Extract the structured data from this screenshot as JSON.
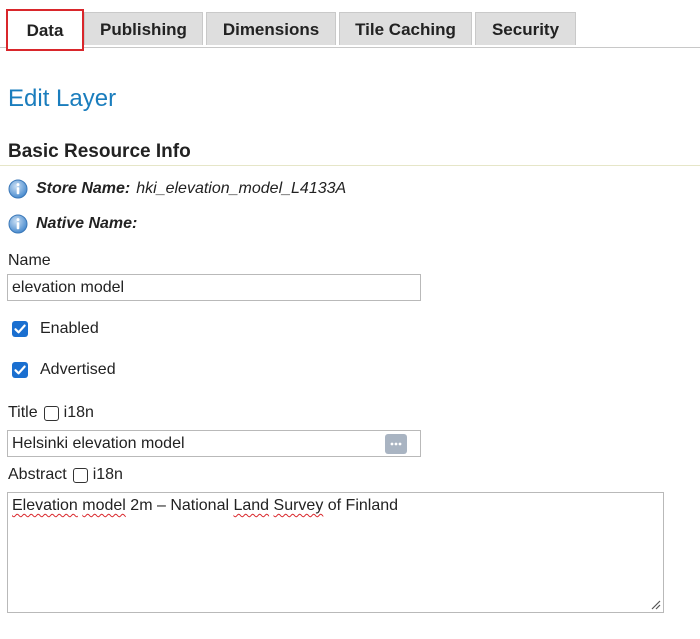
{
  "tabs": [
    {
      "label": "Data",
      "active": true
    },
    {
      "label": "Publishing",
      "active": false
    },
    {
      "label": "Dimensions",
      "active": false
    },
    {
      "label": "Tile Caching",
      "active": false
    },
    {
      "label": "Security",
      "active": false
    }
  ],
  "page_title": "Edit Layer",
  "section_title": "Basic Resource Info",
  "info": {
    "store_key": "Store Name:",
    "store_value": "hki_elevation_model_L4133A",
    "native_key": "Native Name:",
    "native_value": ""
  },
  "name_field": {
    "label": "Name",
    "value": "elevation model"
  },
  "enabled": {
    "label": "Enabled",
    "checked": true
  },
  "advertised": {
    "label": "Advertised",
    "checked": true
  },
  "title_field": {
    "label": "Title",
    "i18n_label": "i18n",
    "i18n_checked": false,
    "value": "Helsinki elevation model"
  },
  "abstract_field": {
    "label": "Abstract",
    "i18n_label": "i18n",
    "i18n_checked": false,
    "words": [
      {
        "text": "Elevation",
        "misspelled": true
      },
      {
        "text": " ",
        "misspelled": false
      },
      {
        "text": "model",
        "misspelled": true
      },
      {
        "text": " 2m – National ",
        "misspelled": false
      },
      {
        "text": "Land",
        "misspelled": true
      },
      {
        "text": " ",
        "misspelled": false
      },
      {
        "text": "Survey",
        "misspelled": true
      },
      {
        "text": " of Finland",
        "misspelled": false
      }
    ]
  },
  "colors": {
    "accent_blue": "#1a7dbd",
    "active_tab_border": "#d9262b",
    "checkbox_blue": "#1a6fd0",
    "info_icon_blue": "#4a8ccf"
  }
}
